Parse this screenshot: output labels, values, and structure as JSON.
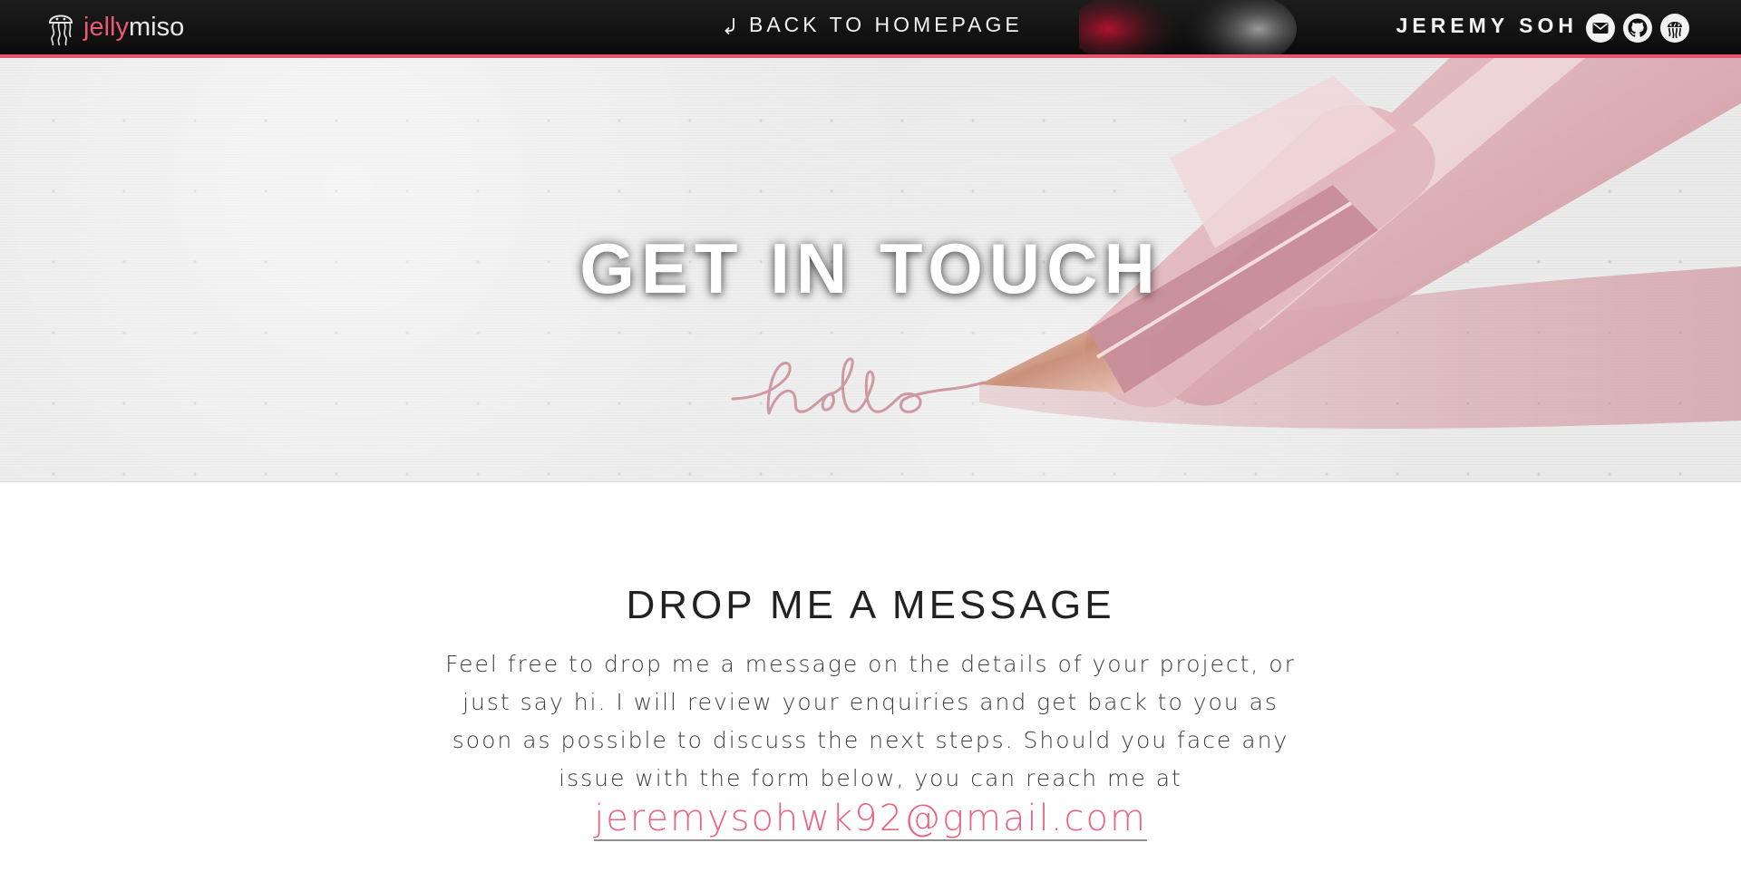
{
  "nav": {
    "brand_part1": "jelly",
    "brand_part2": "miso",
    "back_label": "BACK TO HOMEPAGE",
    "owner_name": "JEREMY SOH",
    "social_icons": [
      "mail-icon",
      "github-icon",
      "dev-profile-icon"
    ]
  },
  "hero": {
    "title": "GET IN TOUCH",
    "script_word": "hello"
  },
  "contact": {
    "heading": "DROP ME A MESSAGE",
    "body": "Feel free to drop me a message on the details of your project, or just say hi. I will review your enquiries and get back to you as soon as possible to discuss the next steps. Should you face any issue with the form below, you can reach me at",
    "email": "jeremysohwk92@gmail.com"
  },
  "colors": {
    "accent": "#e5536e",
    "nav_bg": "#111111",
    "heading": "#222222",
    "body_text": "#3e3e3e",
    "link": "#e96480"
  }
}
